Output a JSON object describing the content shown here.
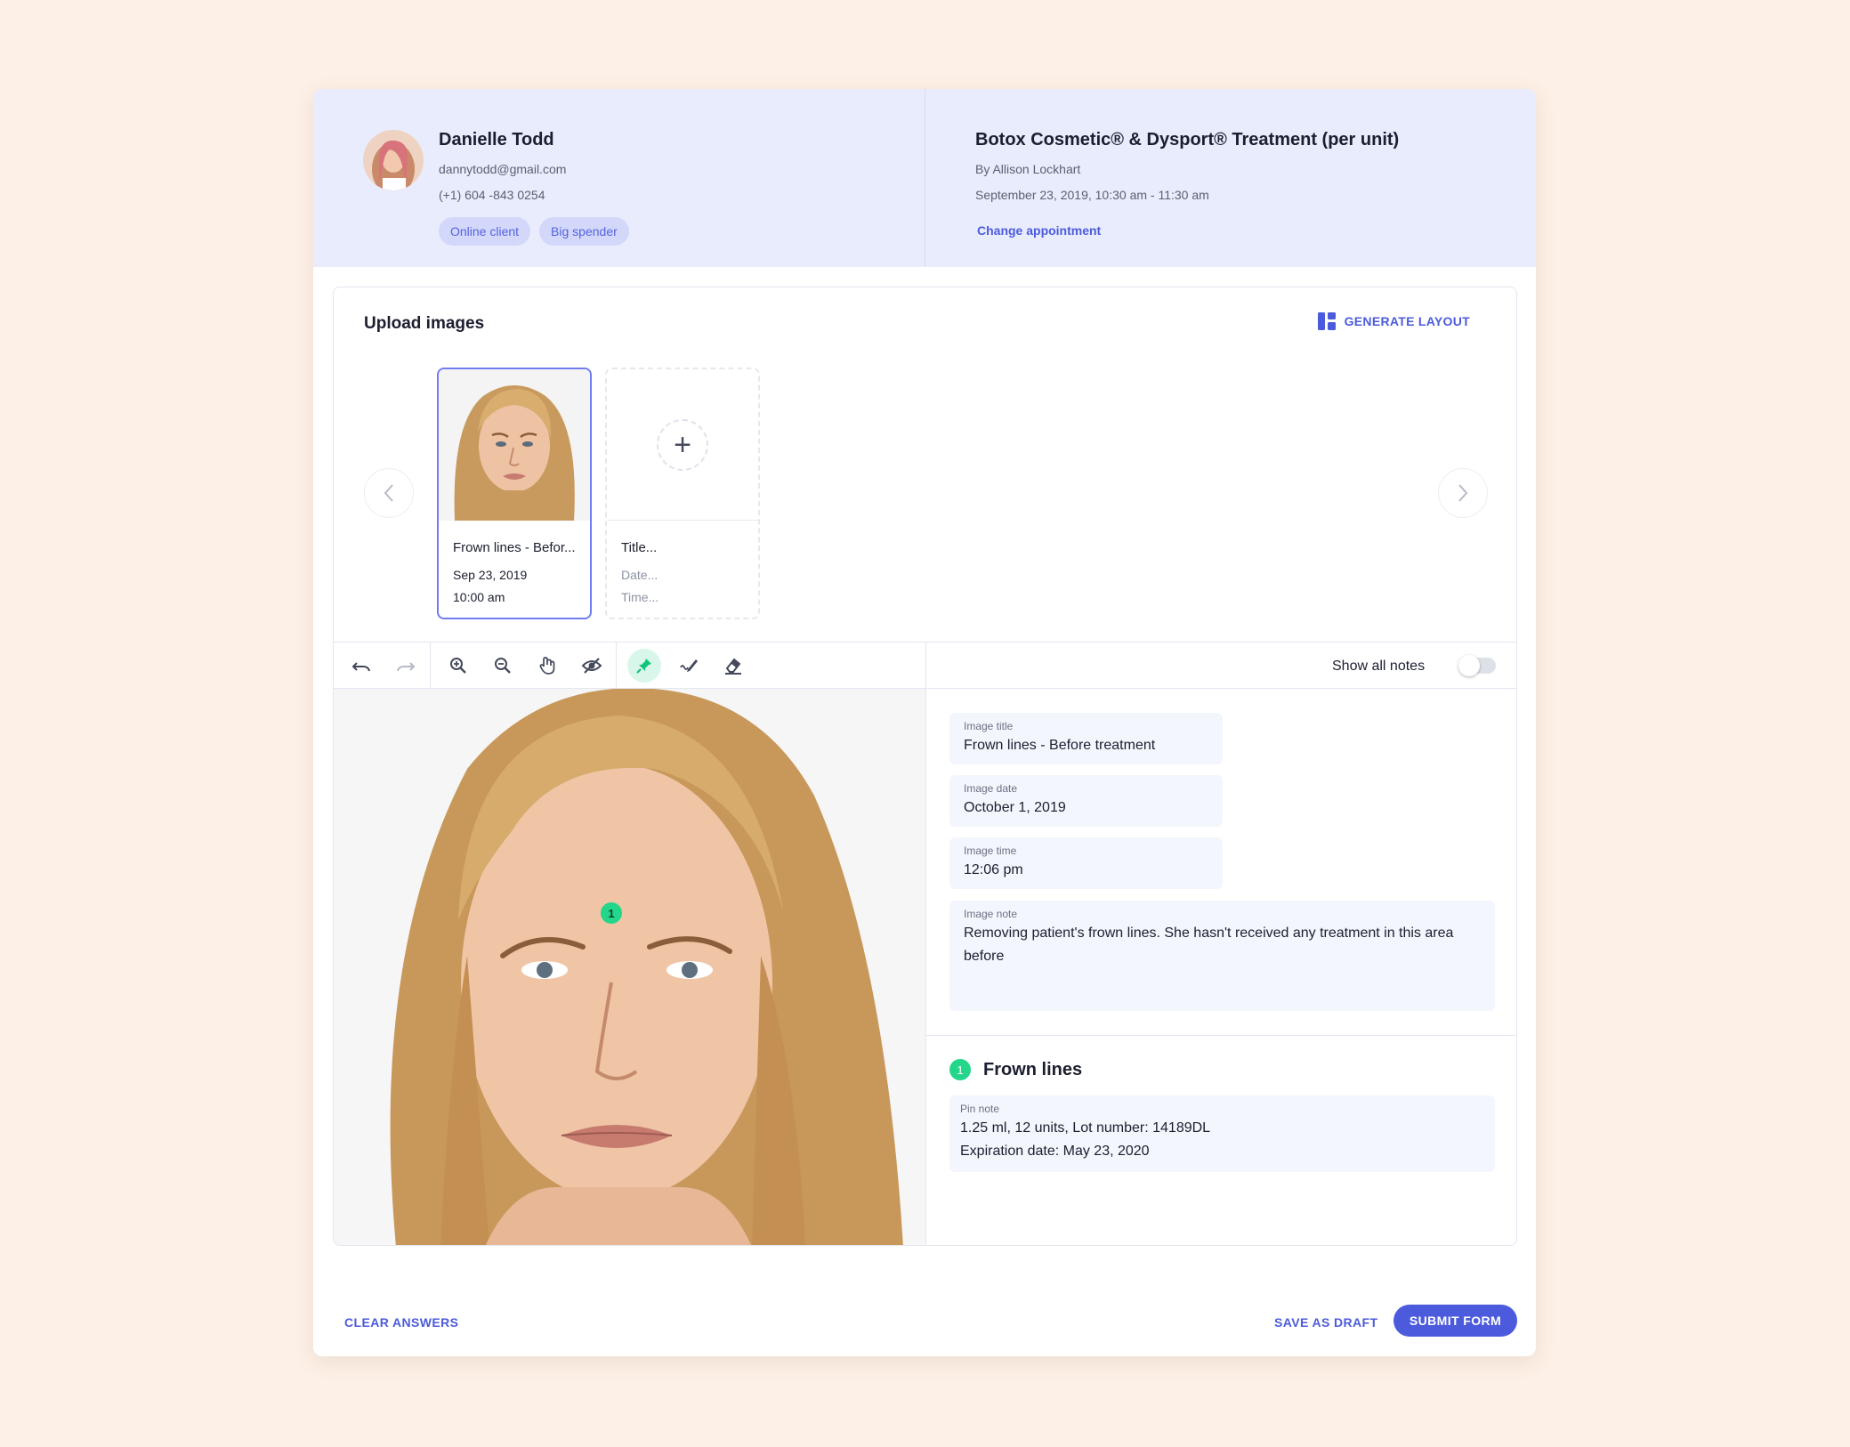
{
  "client": {
    "name": "Danielle Todd",
    "email": "dannytodd@gmail.com",
    "phone": "(+1) 604 -843 0254",
    "tags": [
      "Online client",
      "Big spender"
    ]
  },
  "appointment": {
    "title": "Botox Cosmetic® & Dysport® Treatment (per unit)",
    "by": "By Allison Lockhart",
    "datetime": "September 23, 2019, 10:30 am - 11:30 am",
    "change_label": "Change appointment"
  },
  "upload": {
    "title": "Upload images",
    "generate_label": "GENERATE LAYOUT",
    "thumbnails": [
      {
        "title": "Frown lines - Befor...",
        "date": "Sep 23, 2019",
        "time": "10:00 am"
      },
      {
        "title": "Title...",
        "date": "Date...",
        "time": "Time..."
      }
    ]
  },
  "toolbar": {
    "tools": [
      "undo-icon",
      "redo-icon",
      "zoom-in-icon",
      "zoom-out-icon",
      "hand-icon",
      "hide-icon",
      "pin-icon",
      "draw-icon",
      "eraser-icon"
    ],
    "active_tool": "pin-icon",
    "show_notes_label": "Show all notes",
    "show_notes_on": false
  },
  "editor": {
    "pin_number": "1"
  },
  "image_fields": {
    "title": {
      "label": "Image title",
      "value": "Frown lines - Before treatment"
    },
    "date": {
      "label": "Image date",
      "value": "October 1, 2019"
    },
    "time": {
      "label": "Image time",
      "value": "12:06 pm"
    },
    "note": {
      "label": "Image note",
      "value": "Removing patient's frown lines. She hasn't received any treatment in this area before"
    }
  },
  "pin_note": {
    "number": "1",
    "title": "Frown lines",
    "label": "Pin note",
    "line1": "1.25 ml, 12 units, Lot number: 14189DL",
    "line2": "Expiration date: May 23, 2020"
  },
  "footer": {
    "clear_label": "CLEAR ANSWERS",
    "draft_label": "SAVE AS DRAFT",
    "submit_label": "SUBMIT FORM"
  },
  "colors": {
    "accent": "#4c5bdc",
    "header_bg": "#e9ecfd",
    "pin_green": "#22d68a",
    "page_bg": "#fdf0e6"
  }
}
